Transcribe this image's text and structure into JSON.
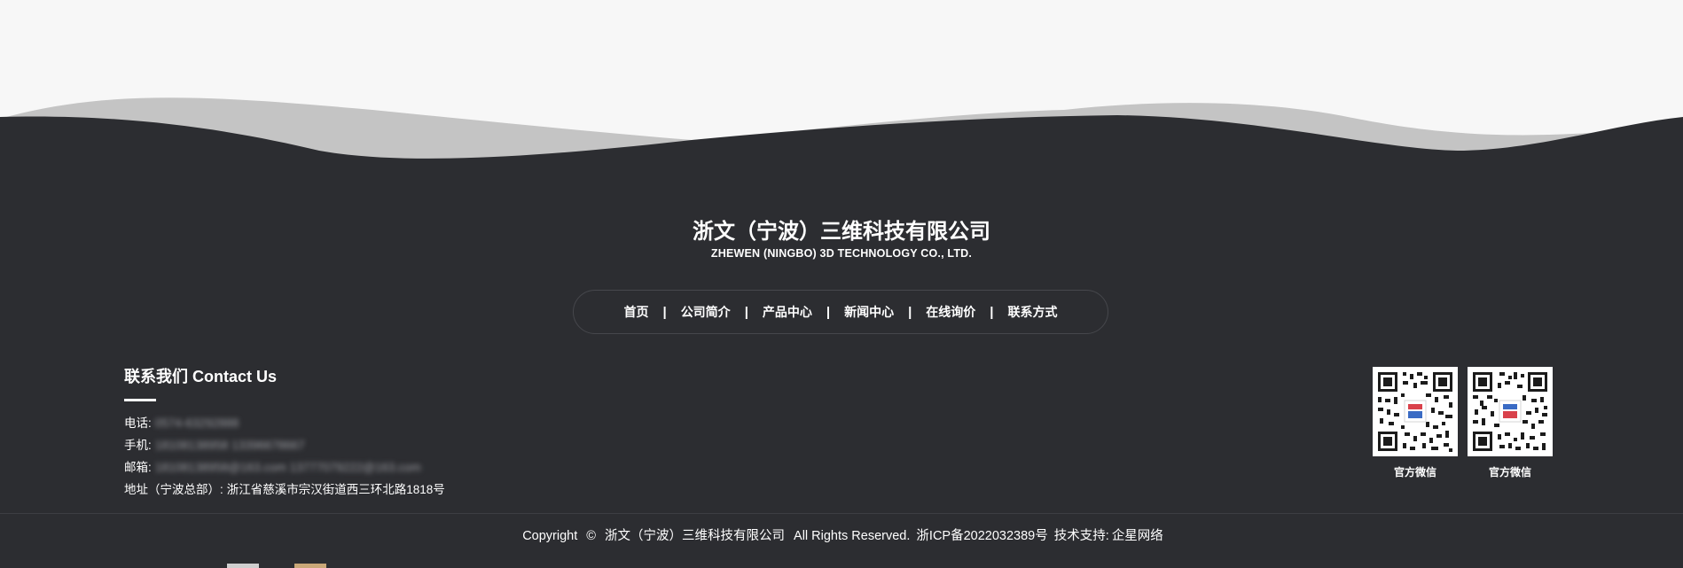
{
  "colors": {
    "page_bg": "#f7f7f7",
    "footer_bg": "#2c2d31",
    "wave_back": "#c4c4c4",
    "text": "#ffffff",
    "muted": "#9a9ba0"
  },
  "brand": {
    "name_cn": "浙文（宁波）三维科技有限公司",
    "name_en": "ZHEWEN (NINGBO) 3D TECHNOLOGY CO., LTD."
  },
  "nav": {
    "items": [
      {
        "label": "首页"
      },
      {
        "label": "公司简介"
      },
      {
        "label": "产品中心"
      },
      {
        "label": "新闻中心"
      },
      {
        "label": "在线询价"
      },
      {
        "label": "联系方式"
      }
    ],
    "separator": "|"
  },
  "contact": {
    "title": "联系我们 Contact Us",
    "phone_label": "电话:",
    "phone_value": "0574-63292888",
    "mobile_label": "手机:",
    "mobile_value": "18108138958   13396678667",
    "email_label": "邮箱:",
    "email_value": "18108138958@163.com   13777079222@163.com",
    "address_label": "地址（宁波总部）:",
    "address_value": "浙江省慈溪市宗汉街道西三环北路1818号"
  },
  "qr_codes": [
    {
      "label": "官方微信",
      "icon": "qr-code-icon"
    },
    {
      "label": "官方微信",
      "icon": "qr-code-icon"
    }
  ],
  "footer": {
    "copyright_word": "Copyright",
    "copyright_symbol": "©",
    "company": "浙文（宁波）三维科技有限公司",
    "rights": "All Rights Reserved.",
    "icp": "浙ICP备2022032389号",
    "support_label": "技术支持:",
    "support_value": "企星网络"
  }
}
